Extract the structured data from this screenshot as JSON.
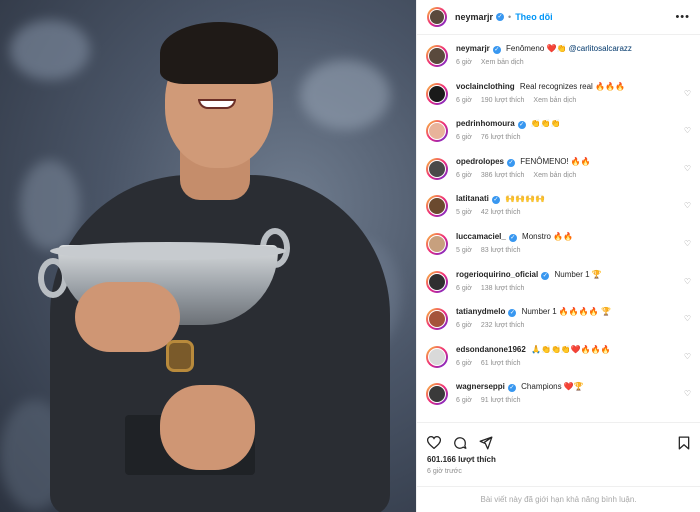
{
  "post": {
    "image_alt": "Carlos Alcaraz holding the Roland Garros trophy",
    "author": {
      "username": "neymarjr",
      "follow_label": "Theo dõi",
      "separator": "•",
      "more_icon": "more-horizontal-icon"
    },
    "caption": {
      "username": "neymarjr",
      "text": "Fenômeno ❤️👏",
      "mention": "@carlitosalcarazz",
      "time": "6 giờ",
      "translate": "Xem bản dịch"
    },
    "comments": [
      {
        "username": "voclaincIothing",
        "verified": false,
        "text": "Real recognizes real 🔥🔥🔥",
        "time": "6 giờ",
        "likes": "190 lượt thích",
        "translate": "Xem bản dịch",
        "avatar_color": "#1a1a1a"
      },
      {
        "username": "pedrinhomoura",
        "verified": true,
        "text": "👏👏👏",
        "time": "6 giờ",
        "likes": "76 lượt thích",
        "translate": "",
        "avatar_color": "#e8b39a"
      },
      {
        "username": "opedrolopes",
        "verified": true,
        "text": "FENÔMENO! 🔥🔥",
        "time": "6 giờ",
        "likes": "386 lượt thích",
        "translate": "Xem bản dịch",
        "avatar_color": "#4a4a4a"
      },
      {
        "username": "latitanati",
        "verified": true,
        "text": "🙌🙌🙌🙌",
        "time": "5 giờ",
        "likes": "42 lượt thích",
        "translate": "",
        "avatar_color": "#6b4a2f"
      },
      {
        "username": "luccamaciel_",
        "verified": true,
        "text": "Monstro 🔥🔥",
        "time": "5 giờ",
        "likes": "83 lượt thích",
        "translate": "",
        "avatar_color": "#c7a07e"
      },
      {
        "username": "rogerioquirino_oficial",
        "verified": true,
        "text": "Number 1 🏆",
        "time": "6 giờ",
        "likes": "138 lượt thích",
        "translate": "",
        "avatar_color": "#2f2f2f"
      },
      {
        "username": "tatianydmelo",
        "verified": true,
        "text": "Number 1 🔥🔥🔥🔥 🏆",
        "time": "6 giờ",
        "likes": "232 lượt thích",
        "translate": "",
        "avatar_color": "#a5533b"
      },
      {
        "username": "edsondanone1962",
        "verified": false,
        "text": "🙏👏👏👏❤️🔥🔥🔥",
        "time": "6 giờ",
        "likes": "61 lượt thích",
        "translate": "",
        "avatar_color": "#d9d9d9"
      },
      {
        "username": "wagnerseppi",
        "verified": true,
        "text": "Champions ❤️🏆",
        "time": "6 giờ",
        "likes": "91 lượt thích",
        "translate": "",
        "avatar_color": "#3a3a3a"
      }
    ],
    "likes_count": "601.166 lượt thích",
    "posted_ago": "6 giờ trước",
    "comments_limited": "Bài viết này đã giới hạn khả năng bình luận."
  },
  "colors": {
    "accent_blue": "#0095f6",
    "verified_blue": "#3897f0",
    "muted_gray": "#8e8e8e",
    "story_ring": [
      "#f9ce34",
      "#ee2a7b",
      "#6228d7"
    ]
  }
}
